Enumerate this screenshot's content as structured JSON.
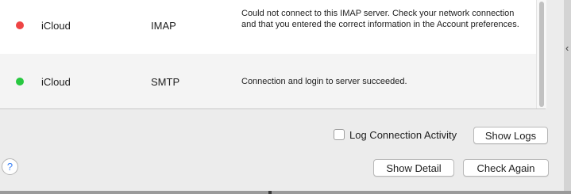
{
  "table": {
    "rows": [
      {
        "status_color": "#ee4444",
        "account": "iCloud",
        "type": "IMAP",
        "message": "Could not connect to this IMAP server. Check your network connection and that you entered the correct information in the Account preferences."
      },
      {
        "status_color": "#28c840",
        "account": "iCloud",
        "type": "SMTP",
        "message": "Connection and login to server succeeded."
      }
    ]
  },
  "options": {
    "log_activity_label": "Log Connection Activity",
    "log_activity_checked": false,
    "show_logs_label": "Show Logs"
  },
  "footer": {
    "help_label": "?",
    "show_detail_label": "Show Detail",
    "check_again_label": "Check Again"
  },
  "icons": {
    "help": "question-mark-icon",
    "status": "status-dot-icon",
    "edge": "chevron-left-icon"
  }
}
